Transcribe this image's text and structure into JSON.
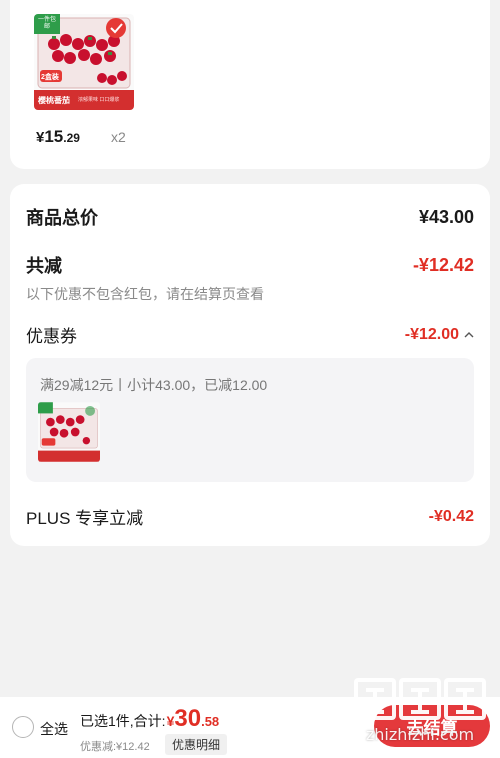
{
  "product": {
    "image_label": "樱桃番茄",
    "image_sub": "2盒装",
    "image_badge": "一件包邮",
    "image_caption": "浓郁果味 口口爆浆",
    "price_currency": "¥",
    "price_integer": "15",
    "price_decimal": ".29",
    "quantity": "x2"
  },
  "summary": {
    "total_label": "商品总价",
    "total_value": "¥43.00",
    "reduction_label": "共减",
    "reduction_value": "-¥12.42",
    "note": "以下优惠不包含红包，请在结算页查看",
    "coupon_label": "优惠券",
    "coupon_value": "-¥12.00",
    "coupon_expand_icon": "chevron-up-icon",
    "coupon_detail": "满29减12元丨小计43.00，已减12.00",
    "plus_label": "PLUS 专享立减",
    "plus_value": "-¥0.42"
  },
  "bottom_bar": {
    "select_all": "全选",
    "selected_text": "已选1件,合计:",
    "total_currency": "¥",
    "total_integer": "30",
    "total_decimal": ".58",
    "discount_text": "优惠减:¥12.42",
    "detail_button": "优惠明细",
    "checkout_button": "去结算"
  },
  "watermark": {
    "text": "zhizhizhi.com"
  },
  "colors": {
    "accent_red": "#e02e24",
    "background": "#f2f2f2",
    "card": "#ffffff"
  }
}
